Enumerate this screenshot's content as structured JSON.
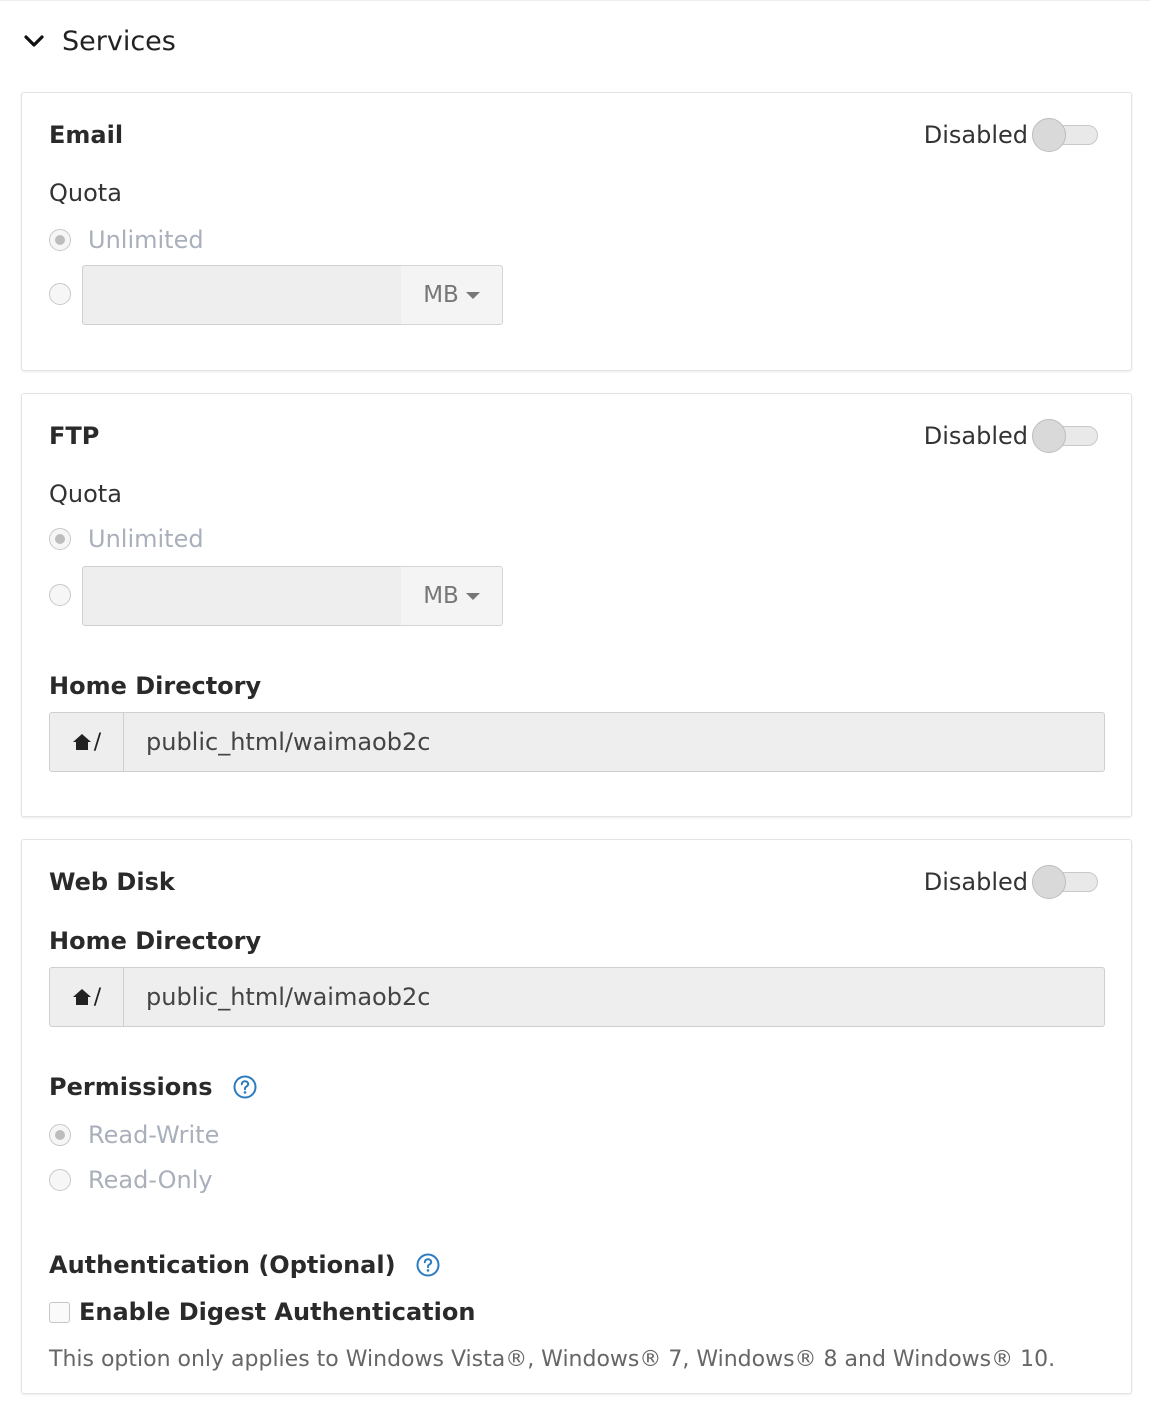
{
  "section": {
    "title": "Services",
    "icon": "chevron-down-icon"
  },
  "email": {
    "title": "Email",
    "toggle_label": "Disabled",
    "quota_label": "Quota",
    "unlimited_label": "Unlimited",
    "quota_value": "",
    "unit": "MB"
  },
  "ftp": {
    "title": "FTP",
    "toggle_label": "Disabled",
    "quota_label": "Quota",
    "unlimited_label": "Unlimited",
    "quota_value": "",
    "unit": "MB",
    "home_dir_label": "Home Directory",
    "home_prefix": "/",
    "home_dir_value": "public_html/waimaob2c"
  },
  "webdisk": {
    "title": "Web Disk",
    "toggle_label": "Disabled",
    "home_dir_label": "Home Directory",
    "home_prefix": "/",
    "home_dir_value": "public_html/waimaob2c",
    "permissions_label": "Permissions",
    "perm_rw": "Read-Write",
    "perm_ro": "Read-Only",
    "auth_label": "Authentication (Optional)",
    "digest_label": "Enable Digest Authentication",
    "help_text": "This option only applies to Windows Vista®, Windows® 7, Windows® 8 and Windows® 10."
  },
  "colors": {
    "help_blue": "#2b7bc0",
    "disabled_text": "#a9b0bb"
  }
}
